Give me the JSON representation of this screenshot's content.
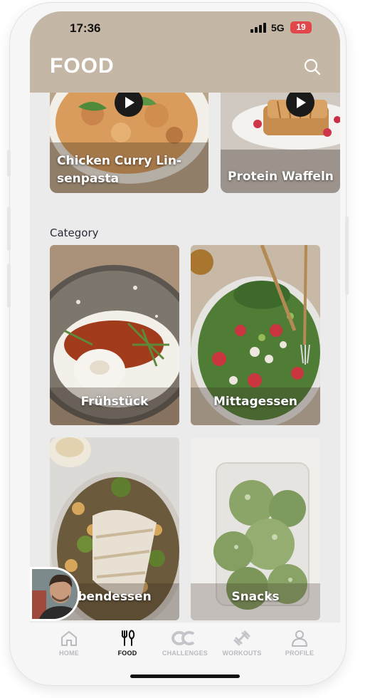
{
  "status_bar": {
    "time": "17:36",
    "network": "5G",
    "battery": "19"
  },
  "header": {
    "title": "FOOD",
    "search_icon": "search-icon"
  },
  "recipes": [
    {
      "title": "Chicken Curry Lin-senpasta",
      "title_line1": "Chicken Curry Lin-",
      "title_line2": "senpasta",
      "icon": "play-icon"
    },
    {
      "title": "Protein Waffeln",
      "icon": "play-icon"
    }
  ],
  "category": {
    "title": "Category",
    "items": [
      {
        "label": "Frühstück"
      },
      {
        "label": "Mittagessen"
      },
      {
        "label": "bendessen"
      },
      {
        "label": "Snacks"
      }
    ]
  },
  "tabbar": {
    "items": [
      {
        "label": "HOME",
        "icon": "home-icon",
        "active": false
      },
      {
        "label": "FOOD",
        "icon": "cutlery-icon",
        "active": true
      },
      {
        "label": "CHALLENGES",
        "icon": "challenges-icon",
        "active": false
      },
      {
        "label": "WORKOUTS",
        "icon": "dumbbell-icon",
        "active": false
      },
      {
        "label": "PROFILE",
        "icon": "user-icon",
        "active": false
      }
    ]
  },
  "colors": {
    "header": "#c5b7a5",
    "background": "#ebebeb",
    "battery": "#e0464a",
    "tab_inactive": "#b9b9c0"
  }
}
